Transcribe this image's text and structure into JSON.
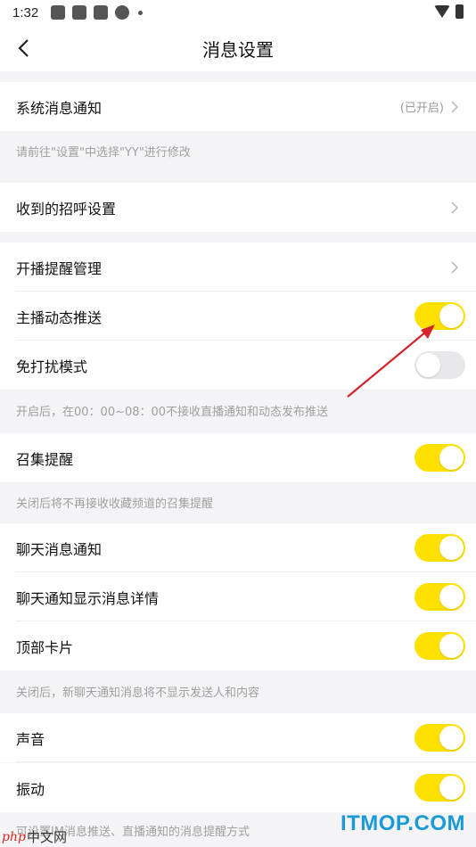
{
  "status_bar": {
    "time": "1:32"
  },
  "header": {
    "title": "消息设置"
  },
  "sections": {
    "system": {
      "label": "系统消息通知",
      "value": "(已开启)",
      "note": "请前往\"设置\"中选择\"YY\"进行修改"
    },
    "greeting": {
      "label": "收到的招呼设置"
    },
    "live": {
      "reminder_label": "开播提醒管理",
      "anchor_push_label": "主播动态推送",
      "anchor_push_on": true,
      "dnd_label": "免打扰模式",
      "dnd_on": false,
      "note": "开启后，在00：00~08：00不接收直播通知和动态发布推送"
    },
    "gather": {
      "label": "召集提醒",
      "on": true,
      "note": "关闭后将不再接收收藏频道的召集提醒"
    },
    "chat": {
      "notify_label": "聊天消息通知",
      "detail_label": "聊天通知显示消息详情",
      "topcard_label": "顶部卡片",
      "note": "关闭后，新聊天通知消息将不显示发送人和内容"
    },
    "alert": {
      "sound_label": "声音",
      "vibrate_label": "振动",
      "note": "可设置IM消息推送、直播通知的消息提醒方式"
    }
  },
  "colors": {
    "toggle_on": "#ffe100",
    "toggle_off": "#e8e8ea",
    "background": "#f4f4f6",
    "annotation_arrow": "#d8232a"
  },
  "watermarks": {
    "left_brand": "php",
    "left_text": "中文网",
    "right_text": "ITMOP.COM"
  }
}
